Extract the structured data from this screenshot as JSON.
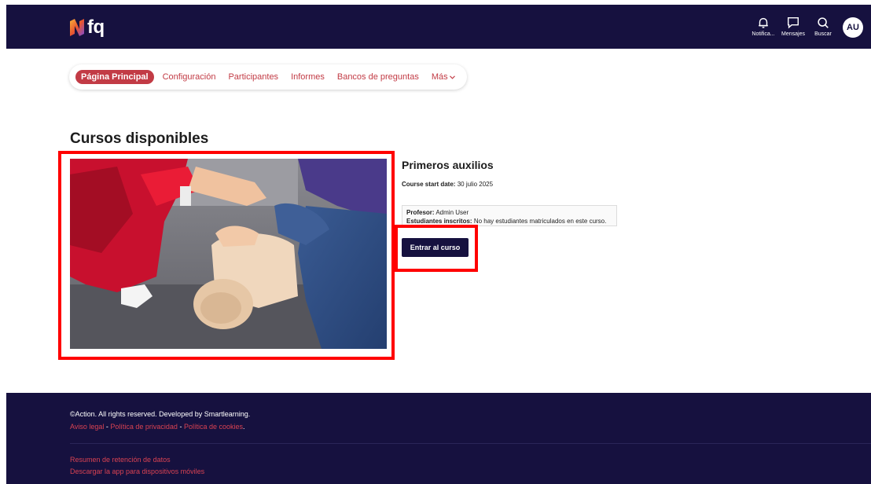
{
  "header": {
    "logo_text": "fq",
    "tools": [
      {
        "name": "notifications",
        "label": "Notifica..."
      },
      {
        "name": "messages",
        "label": "Mensajes"
      },
      {
        "name": "search",
        "label": "Buscar"
      }
    ],
    "avatar_initials": "AU"
  },
  "secondary_nav": {
    "items": [
      "Página Principal",
      "Configuración",
      "Participantes",
      "Informes",
      "Bancos de preguntas"
    ],
    "more_label": "Más"
  },
  "main": {
    "title": "Cursos disponibles",
    "course": {
      "name": "Primeros auxilios",
      "start_date_label": "Course start date:",
      "start_date_value": "30 julio 2025",
      "teacher_label": "Profesor:",
      "teacher_value": "Admin User",
      "students_label": "Estudiantes inscritos:",
      "students_value": "No hay estudiantes matriculados en este curso.",
      "enter_button": "Entrar al curso"
    }
  },
  "footer": {
    "copyright": "©Action. All rights reserved. Developed by Smartlearning.",
    "legal_links": [
      "Aviso legal",
      "Política de privacidad",
      "Política de cookies"
    ],
    "separator": " - ",
    "legal_end": ".",
    "bottom_links": [
      "Resumen de retención de datos",
      "Descargar la app para dispositivos móviles"
    ]
  },
  "colors": {
    "header_bg": "#16113f",
    "accent": "#c23b45",
    "highlight_box": "#ff0000"
  }
}
